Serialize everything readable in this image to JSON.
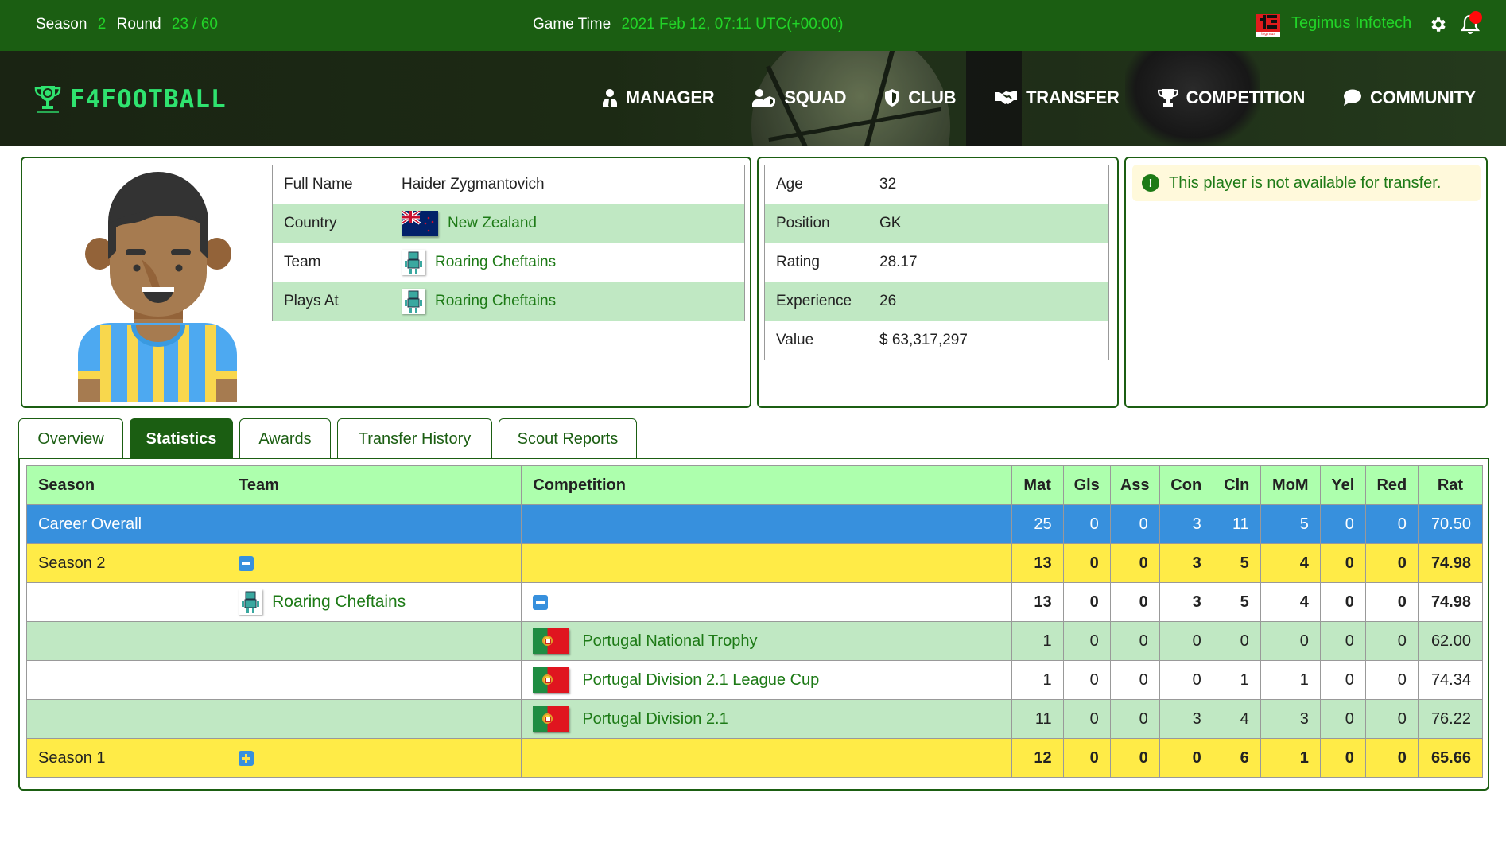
{
  "topbar": {
    "season_label": "Season",
    "season_value": "2",
    "round_label": "Round",
    "round_value": "23 / 60",
    "game_time_label": "Game Time",
    "game_time_value": "2021 Feb 12, 07:11 UTC(+00:00)",
    "company_name": "Tegimus Infotech",
    "company_logo_caption": "tegimus",
    "icons": {
      "settings": "gear-icon",
      "notifications": "bell-icon"
    },
    "notification_dot_color": "#ff0a0a"
  },
  "brand": {
    "name": "F4FOOTBALL",
    "color": "#2fe36f"
  },
  "nav": [
    {
      "label": "MANAGER",
      "icon": "manager-icon"
    },
    {
      "label": "SQUAD",
      "icon": "squad-icon"
    },
    {
      "label": "CLUB",
      "icon": "shield-icon"
    },
    {
      "label": "TRANSFER",
      "icon": "handshake-icon"
    },
    {
      "label": "COMPETITION",
      "icon": "trophy-icon"
    },
    {
      "label": "COMMUNITY",
      "icon": "chat-icon"
    }
  ],
  "player": {
    "info": [
      {
        "label": "Full Name",
        "value": "Haider Zygmantovich"
      },
      {
        "label": "Country",
        "value": "New Zealand",
        "icon": "flag-new-zealand-icon"
      },
      {
        "label": "Team",
        "value": "Roaring Cheftains",
        "icon": "team-badge-icon"
      },
      {
        "label": "Plays At",
        "value": "Roaring Cheftains",
        "icon": "team-badge-icon"
      }
    ],
    "attributes": [
      {
        "label": "Age",
        "value": "32"
      },
      {
        "label": "Position",
        "value": "GK"
      },
      {
        "label": "Rating",
        "value": "28.17"
      },
      {
        "label": "Experience",
        "value": "26"
      },
      {
        "label": "Value",
        "value": "$ 63,317,297"
      }
    ],
    "transfer_notice": "This player is not available for transfer."
  },
  "tabs": [
    {
      "label": "Overview",
      "active": false
    },
    {
      "label": "Statistics",
      "active": true
    },
    {
      "label": "Awards",
      "active": false
    },
    {
      "label": "Transfer History",
      "active": false
    },
    {
      "label": "Scout Reports",
      "active": false
    }
  ],
  "stats": {
    "columns": [
      "Season",
      "Team",
      "Competition",
      "Mat",
      "Gls",
      "Ass",
      "Con",
      "Cln",
      "MoM",
      "Yel",
      "Red",
      "Rat"
    ],
    "rows": [
      {
        "type": "career",
        "season": "Career Overall",
        "team": "",
        "competition": "",
        "values": [
          "25",
          "0",
          "0",
          "3",
          "11",
          "5",
          "0",
          "0",
          "70.50"
        ]
      },
      {
        "type": "season",
        "season": "Season 2",
        "toggle": "collapse",
        "values": [
          "13",
          "0",
          "0",
          "3",
          "5",
          "4",
          "0",
          "0",
          "74.98"
        ]
      },
      {
        "type": "team",
        "team": "Roaring Cheftains",
        "toggle": "collapse",
        "values": [
          "13",
          "0",
          "0",
          "3",
          "5",
          "4",
          "0",
          "0",
          "74.98"
        ]
      },
      {
        "type": "competition",
        "competition": "Portugal National Trophy",
        "flag": "flag-portugal-icon",
        "values": [
          "1",
          "0",
          "0",
          "0",
          "0",
          "0",
          "0",
          "0",
          "62.00"
        ]
      },
      {
        "type": "competition",
        "competition": "Portugal Division 2.1 League Cup",
        "flag": "flag-portugal-icon",
        "values": [
          "1",
          "0",
          "0",
          "0",
          "1",
          "1",
          "0",
          "0",
          "74.34"
        ]
      },
      {
        "type": "competition",
        "competition": "Portugal Division 2.1",
        "flag": "flag-portugal-icon",
        "values": [
          "11",
          "0",
          "0",
          "3",
          "4",
          "3",
          "0",
          "0",
          "76.22"
        ]
      },
      {
        "type": "season",
        "season": "Season 1",
        "toggle": "expand",
        "values": [
          "12",
          "0",
          "0",
          "0",
          "6",
          "1",
          "0",
          "0",
          "65.66"
        ]
      }
    ]
  },
  "colors": {
    "primary": "#1b5e12",
    "accent_green": "#22d428",
    "link": "#1d7a16",
    "header_row": "#adffad",
    "career_row": "#3790dd",
    "season_row": "#ffeb47",
    "stripe_row": "#c0e8c3",
    "alert_bg": "#fff9db"
  }
}
